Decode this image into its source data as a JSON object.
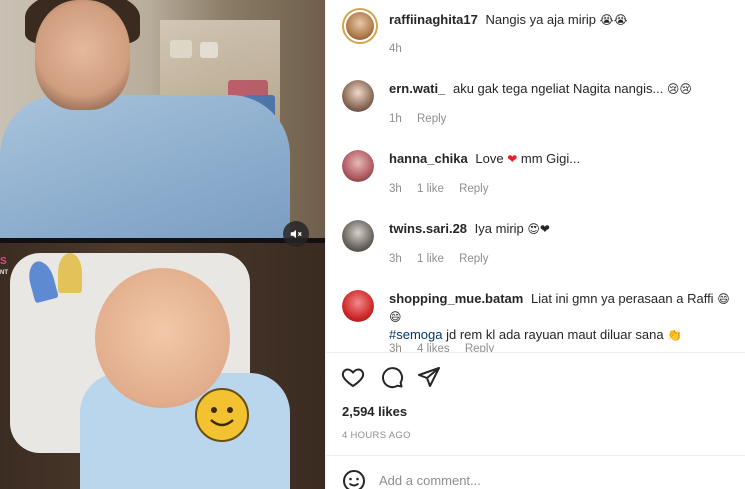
{
  "media": {
    "top_description_icon": "video-frame-top",
    "bottom_description_icon": "video-frame-bottom",
    "logo_text": "S\nNT",
    "mute_icon": "speaker-muted-icon"
  },
  "caption": {
    "username": "raffiinaghita17",
    "text": "Nangis ya aja mirip",
    "emoji": "😭😭",
    "time": "4h"
  },
  "comments": [
    {
      "username": "ern.wati_",
      "text": "aku gak tega ngeliat Nagita nangis...",
      "emoji": "😢😢",
      "time": "1h",
      "likes": "",
      "reply": "Reply"
    },
    {
      "username": "hanna_chika",
      "text": "Love",
      "emoji": "❤",
      "text_after": "mm Gigi...",
      "time": "3h",
      "likes": "1 like",
      "reply": "Reply"
    },
    {
      "username": "twins.sari.28",
      "text": "Iya mirip",
      "emoji": "😍❤",
      "time": "3h",
      "likes": "1 like",
      "reply": "Reply"
    },
    {
      "username": "shopping_mue.batam",
      "text": "Liat ini gmn ya perasaan a Raffi",
      "emoji": "😄😄",
      "hashtag": "#semoga",
      "text_line2": "jd rem kl ada rayuan maut diluar sana",
      "emoji2": "👏",
      "time": "3h",
      "likes": "4 likes",
      "reply": "Reply"
    }
  ],
  "actions": {
    "like_icon": "heart-icon",
    "comment_icon": "comment-icon",
    "share_icon": "send-icon"
  },
  "likes_count": "2,594 likes",
  "timestamp": "4 HOURS AGO",
  "add_comment": {
    "placeholder": "Add a comment...",
    "emoji_icon": "smile-icon"
  },
  "colors": {
    "text": "#262626",
    "muted": "#8e8e8e",
    "hashtag": "#00376b",
    "heart": "#ed1c24"
  }
}
